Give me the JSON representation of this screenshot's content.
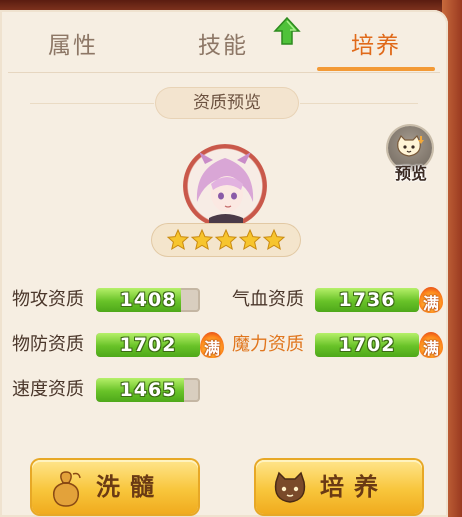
{
  "tabs": [
    {
      "label": "属性",
      "active": false
    },
    {
      "label": "技能",
      "active": false
    },
    {
      "label": "培养",
      "active": true
    }
  ],
  "section": {
    "title": "资质预览"
  },
  "preview": {
    "label": "预览"
  },
  "stars": {
    "count": 5
  },
  "stats": [
    {
      "label": "物攻资质",
      "value": "1408",
      "fill_fraction": 0.82,
      "full": false,
      "full_label": ""
    },
    {
      "label": "气血资质",
      "value": "1736",
      "fill_fraction": 1.0,
      "full": true,
      "full_label": "满"
    },
    {
      "label": "物防资质",
      "value": "1702",
      "fill_fraction": 1.0,
      "full": true,
      "full_label": "满"
    },
    {
      "label": "魔力资质",
      "value": "1702",
      "fill_fraction": 1.0,
      "full": true,
      "full_label": "满"
    },
    {
      "label": "速度资质",
      "value": "1465",
      "fill_fraction": 0.85,
      "full": false,
      "full_label": ""
    }
  ],
  "buttons": {
    "wash_label": "洗髓",
    "train_label": "培养"
  },
  "colors": {
    "accent": "#e06a1a",
    "bar_green": "#68c228",
    "button_gold": "#f8c63c"
  }
}
